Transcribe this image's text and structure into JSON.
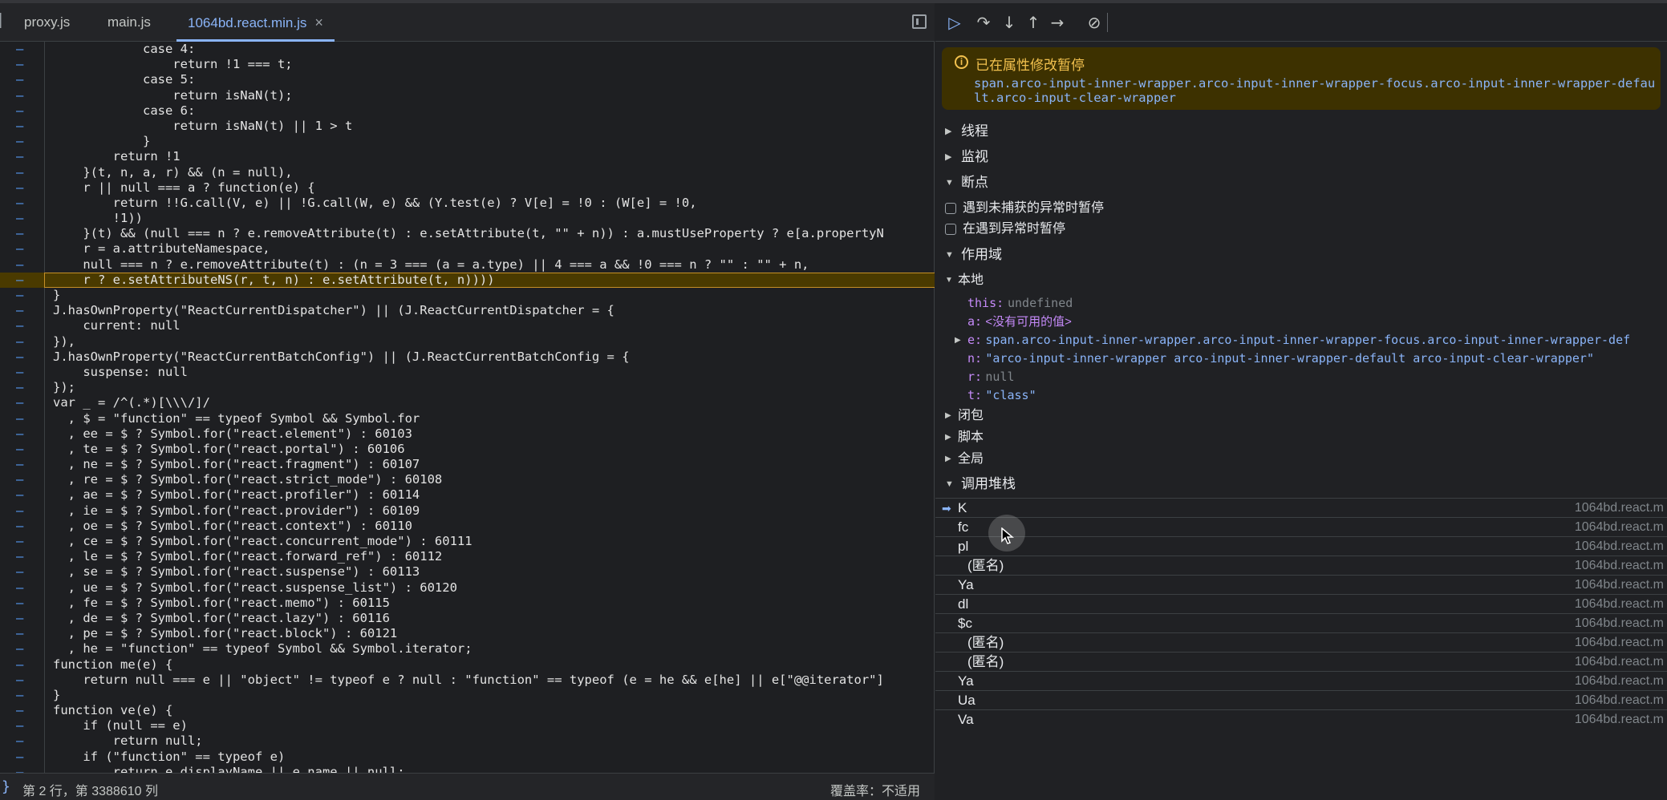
{
  "editor": {
    "tabs": [
      {
        "label": "proxy.js"
      },
      {
        "label": "main.js"
      },
      {
        "label": "1064bd.react.min.js",
        "close": "×"
      }
    ],
    "gutter_mark": "–",
    "lines": [
      "            case 4:",
      "                return !1 === t;",
      "            case 5:",
      "                return isNaN(t);",
      "            case 6:",
      "                return isNaN(t) || 1 > t",
      "            }",
      "        return !1",
      "    }(t, n, a, r) && (n = null),",
      "    r || null === a ? function(e) {",
      "        return !!G.call(V, e) || !G.call(W, e) && (Y.test(e) ? V[e] = !0 : (W[e] = !0,",
      "        !1))",
      "    }(t) && (null === n ? e.removeAttribute(t) : e.setAttribute(t, \"\" + n)) : a.mustUseProperty ? e[a.propertyN",
      "    r = a.attributeNamespace,",
      "    null === n ? e.removeAttribute(t) : (n = 3 === (a = a.type) || 4 === a && !0 === n ? \"\" : \"\" + n,",
      "    r ? e.setAttributeNS(r, t, n) : e.setAttribute(t, n))))",
      "}",
      "J.hasOwnProperty(\"ReactCurrentDispatcher\") || (J.ReactCurrentDispatcher = {",
      "    current: null",
      "}),",
      "J.hasOwnProperty(\"ReactCurrentBatchConfig\") || (J.ReactCurrentBatchConfig = {",
      "    suspense: null",
      "});",
      "var _ = /^(.*)[\\\\\\/]/",
      "  , $ = \"function\" == typeof Symbol && Symbol.for",
      "  , ee = $ ? Symbol.for(\"react.element\") : 60103",
      "  , te = $ ? Symbol.for(\"react.portal\") : 60106",
      "  , ne = $ ? Symbol.for(\"react.fragment\") : 60107",
      "  , re = $ ? Symbol.for(\"react.strict_mode\") : 60108",
      "  , ae = $ ? Symbol.for(\"react.profiler\") : 60114",
      "  , ie = $ ? Symbol.for(\"react.provider\") : 60109",
      "  , oe = $ ? Symbol.for(\"react.context\") : 60110",
      "  , ce = $ ? Symbol.for(\"react.concurrent_mode\") : 60111",
      "  , le = $ ? Symbol.for(\"react.forward_ref\") : 60112",
      "  , se = $ ? Symbol.for(\"react.suspense\") : 60113",
      "  , ue = $ ? Symbol.for(\"react.suspense_list\") : 60120",
      "  , fe = $ ? Symbol.for(\"react.memo\") : 60115",
      "  , de = $ ? Symbol.for(\"react.lazy\") : 60116",
      "  , pe = $ ? Symbol.for(\"react.block\") : 60121",
      "  , he = \"function\" == typeof Symbol && Symbol.iterator;",
      "function me(e) {",
      "    return null === e || \"object\" != typeof e ? null : \"function\" == typeof (e = he && e[he] || e[\"@@iterator\"]",
      "}",
      "function ve(e) {",
      "    if (null == e)",
      "        return null;",
      "    if (\"function\" == typeof e)",
      "        return e.displayName || e.name || null;"
    ],
    "highlight_line_index": 15,
    "status": {
      "brace": "}",
      "position": "第 2 行，第 3388610 列",
      "coverage": "覆盖率：不适用"
    }
  },
  "debugger": {
    "toolbar": [
      {
        "name": "resume-icon",
        "glyph": "▷"
      },
      {
        "name": "step-over-icon",
        "glyph": "↷"
      },
      {
        "name": "step-into-icon",
        "glyph": "↓"
      },
      {
        "name": "step-out-icon",
        "glyph": "↑"
      },
      {
        "name": "step-icon",
        "glyph": "→"
      },
      {
        "name": "deactivate-breakpoints-icon",
        "glyph": "⊘"
      }
    ],
    "paused": {
      "title": "已在属性修改暂停",
      "selector": "span.arco-input-inner-wrapper.arco-input-inner-wrapper-focus.arco-input-inner-wrapper-default.arco-input-clear-wrapper"
    },
    "sections": {
      "threads": "线程",
      "watch": "监视",
      "breakpoints": "断点",
      "scope": "作用域",
      "callstack": "调用堆栈"
    },
    "checkboxes": [
      "遇到未捕获的异常时暂停",
      "在遇到异常时暂停"
    ],
    "scope_groups": {
      "local": "本地",
      "closure": "闭包",
      "script": "脚本",
      "global": "全局"
    },
    "variables": [
      {
        "key": "this:",
        "value": "undefined",
        "style": "gray"
      },
      {
        "key": "a:",
        "value": "<没有可用的值>",
        "style": "ch"
      },
      {
        "key": "e:",
        "value": "span.arco-input-inner-wrapper.arco-input-inner-wrapper-focus.arco-input-inner-wrapper-def",
        "style": "lnk",
        "expandable": true
      },
      {
        "key": "n:",
        "value": "\"arco-input-inner-wrapper arco-input-inner-wrapper-default arco-input-clear-wrapper\"",
        "style": "str"
      },
      {
        "key": "r:",
        "value": "null",
        "style": "gray"
      },
      {
        "key": "t:",
        "value": "\"class\"",
        "style": "str"
      }
    ],
    "frames": [
      {
        "name": "K",
        "loc": "1064bd.react.m",
        "current": true
      },
      {
        "name": "fc",
        "loc": "1064bd.react.m"
      },
      {
        "name": "pl",
        "loc": "1064bd.react.m"
      },
      {
        "name": "(匿名)",
        "loc": "1064bd.react.m",
        "anon": true
      },
      {
        "name": "Ya",
        "loc": "1064bd.react.m"
      },
      {
        "name": "dl",
        "loc": "1064bd.react.m"
      },
      {
        "name": "$c",
        "loc": "1064bd.react.m"
      },
      {
        "name": "(匿名)",
        "loc": "1064bd.react.m",
        "anon": true
      },
      {
        "name": "(匿名)",
        "loc": "1064bd.react.m",
        "anon": true
      },
      {
        "name": "Ya",
        "loc": "1064bd.react.m"
      },
      {
        "name": "Ua",
        "loc": "1064bd.react.m"
      },
      {
        "name": "Va",
        "loc": "1064bd.react.m"
      }
    ],
    "colors": {
      "accent": "#8ab4f8",
      "warning": "#f2c14e",
      "highlight": "#4a3a00"
    }
  }
}
